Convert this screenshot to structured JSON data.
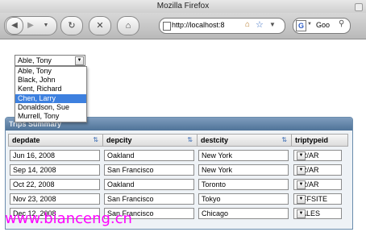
{
  "window": {
    "title": "Mozilla Firefox"
  },
  "toolbar": {
    "url": "http://localhost:8",
    "search_text": "Goo"
  },
  "employee_select": {
    "value": "Able, Tony",
    "options": [
      "Able, Tony",
      "Black, John",
      "Kent, Richard",
      "Chen, Larry",
      "Donaldson, Sue",
      "Murrell, Tony"
    ],
    "highlighted_index": 3
  },
  "panel": {
    "title": "Trips Summary"
  },
  "grid": {
    "columns": [
      "depdate",
      "depcity",
      "destcity",
      "triptypeid"
    ],
    "rows": [
      {
        "depdate": "Jun 16, 2008",
        "depcity": "Oakland",
        "destcity": "New York",
        "triptypeid": "PR/AR"
      },
      {
        "depdate": "Sep 14, 2008",
        "depcity": "San Francisco",
        "destcity": "New York",
        "triptypeid": "PR/AR"
      },
      {
        "depdate": "Oct 22, 2008",
        "depcity": "Oakland",
        "destcity": "Toronto",
        "triptypeid": "PR/AR"
      },
      {
        "depdate": "Nov 23, 2008",
        "depcity": "San Francisco",
        "destcity": "Tokyo",
        "triptypeid": "OFFSITE"
      },
      {
        "depdate": "Dec 12, 2008",
        "depcity": "San Francisco",
        "destcity": "Chicago",
        "triptypeid": "SALES"
      }
    ]
  },
  "watermark": "www.bianceng.cn"
}
